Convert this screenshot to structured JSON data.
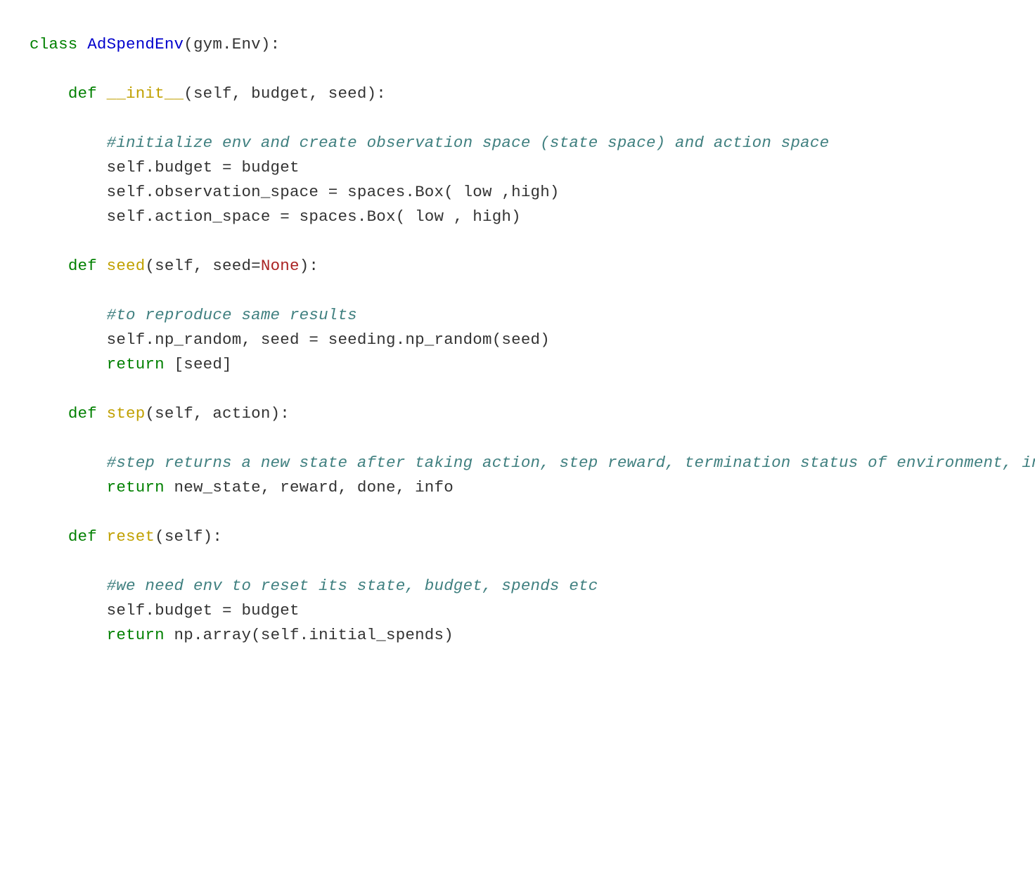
{
  "colors": {
    "keyword": "#008000",
    "classname": "#0000cc",
    "funcname": "#c0a000",
    "comment": "#408080",
    "constant": "#aa2222",
    "text": "#333333",
    "bg": "#ffffff"
  },
  "code": {
    "line1": {
      "kw_class": "class",
      "sp1": " ",
      "name": "AdSpendEnv",
      "tail": "(gym.Env):"
    },
    "blank2": "",
    "line3": {
      "indent": "    ",
      "kw_def": "def",
      "sp1": " ",
      "fn_pre": "__init__",
      "tail": "(self, budget, seed):"
    },
    "blank4": "",
    "line5": {
      "indent": "        ",
      "comment": "#initialize env and create observation space (state space) and action space"
    },
    "line6": {
      "indent": "        ",
      "text": "self.budget = budget"
    },
    "line7": {
      "indent": "        ",
      "text": "self.observation_space = spaces.Box( low ,high)"
    },
    "line8": {
      "indent": "        ",
      "text": "self.action_space = spaces.Box( low , high)"
    },
    "blank9": "",
    "line10": {
      "indent": "    ",
      "kw_def": "def",
      "sp1": " ",
      "fn": "seed",
      "mid": "(self, seed=",
      "none": "None",
      "tail": "):"
    },
    "blank11": "",
    "line12": {
      "indent": "        ",
      "comment": "#to reproduce same results"
    },
    "line13": {
      "indent": "        ",
      "text": "self.np_random, seed = seeding.np_random(seed)"
    },
    "line14": {
      "indent": "        ",
      "kw_return": "return",
      "tail": " [seed]"
    },
    "blank15": "",
    "line16": {
      "indent": "    ",
      "kw_def": "def",
      "sp1": " ",
      "fn": "step",
      "tail": "(self, action):"
    },
    "blank17": "",
    "line18": {
      "indent": "        ",
      "comment": "#step returns a new state after taking action, step reward, termination status of environment, info (this is not used by agent to learn)"
    },
    "line19": {
      "indent": "        ",
      "kw_return": "return",
      "tail": " new_state, reward, done, info"
    },
    "blank20": "",
    "line21": {
      "indent": "    ",
      "kw_def": "def",
      "sp1": " ",
      "fn": "reset",
      "tail": "(self):"
    },
    "blank22": "",
    "line23": {
      "indent": "        ",
      "comment": "#we need env to reset its state, budget, spends etc"
    },
    "line24": {
      "indent": "        ",
      "text": "self.budget = budget"
    },
    "line25": {
      "indent": "        ",
      "kw_return": "return",
      "tail": " np.array(self.initial_spends)"
    }
  }
}
